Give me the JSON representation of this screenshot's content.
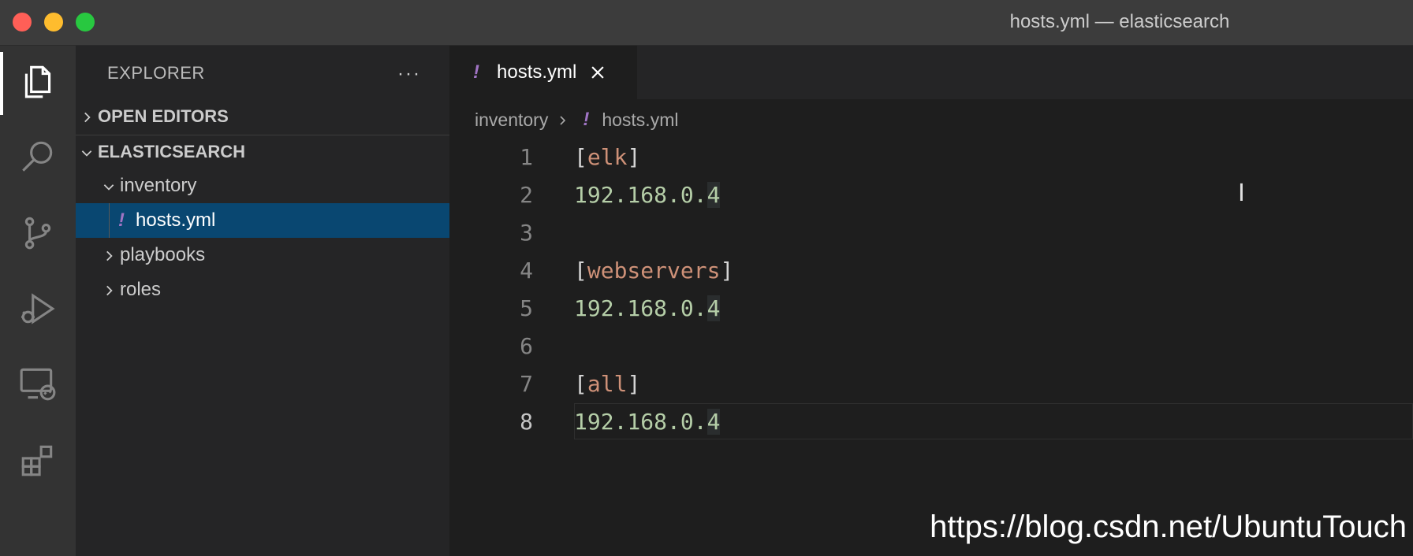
{
  "window": {
    "title": "hosts.yml — elasticsearch"
  },
  "activity_bar": {
    "items": [
      {
        "icon": "files-icon",
        "active": true
      },
      {
        "icon": "search-icon"
      },
      {
        "icon": "source-control-icon"
      },
      {
        "icon": "run-debug-icon"
      },
      {
        "icon": "remote-explorer-icon"
      },
      {
        "icon": "extensions-icon"
      }
    ]
  },
  "sidebar": {
    "title": "EXPLORER",
    "more_label": "···",
    "open_editors": "OPEN EDITORS",
    "workspace": "ELASTICSEARCH",
    "tree": [
      {
        "label": "inventory",
        "type": "folder",
        "expanded": true
      },
      {
        "label": "hosts.yml",
        "type": "file",
        "selected": true
      },
      {
        "label": "playbooks",
        "type": "folder",
        "expanded": false
      },
      {
        "label": "roles",
        "type": "folder",
        "expanded": false
      }
    ]
  },
  "editor": {
    "tab": {
      "label": "hosts.yml",
      "icon_glyph": "!"
    },
    "breadcrumb": {
      "folder": "inventory",
      "file": "hosts.yml"
    },
    "lines": [
      {
        "num": "1",
        "open": "[",
        "name": "elk",
        "close": "]"
      },
      {
        "num": "2",
        "ip_head": "192.168.0.",
        "ip_tail": "4"
      },
      {
        "num": "3"
      },
      {
        "num": "4",
        "open": "[",
        "name": "webservers",
        "close": "]"
      },
      {
        "num": "5",
        "ip_head": "192.168.0.",
        "ip_tail": "4"
      },
      {
        "num": "6"
      },
      {
        "num": "7",
        "open": "[",
        "name": "all",
        "close": "]"
      },
      {
        "num": "8",
        "ip_head": "192.168.0.",
        "ip_tail": "4",
        "current": true
      }
    ]
  },
  "watermark": "https://blog.csdn.net/UbuntuTouch",
  "colors": {
    "selection": "#094771",
    "yaml_icon": "#a074c4",
    "section": "#ce9178",
    "number": "#b5cea8"
  }
}
